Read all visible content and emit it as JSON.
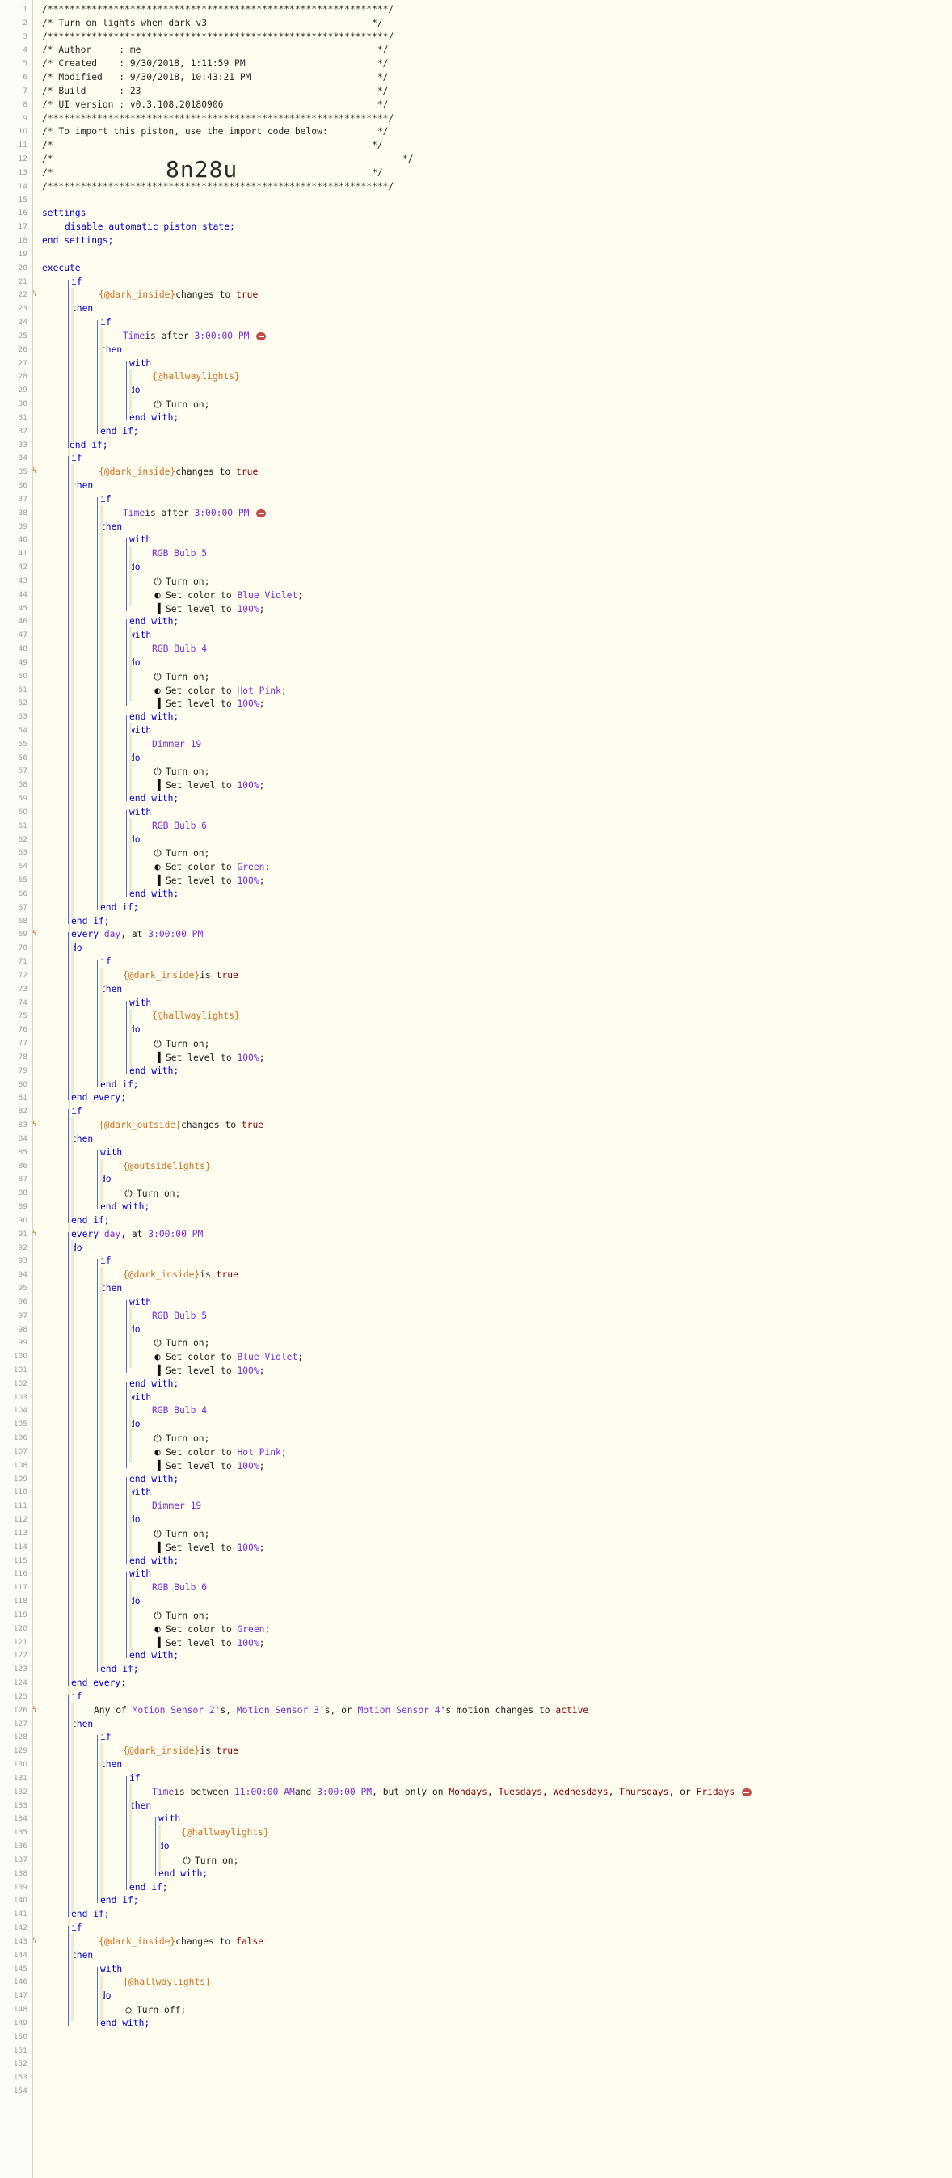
{
  "colors": {
    "keyword": "#0000cc",
    "variable": "#d07020",
    "device": "#7b2fd6",
    "literal": "#8b0000",
    "background": "#fffdf0"
  },
  "line_count": 154,
  "lines": {
    "1": "/**************************************************************/",
    "2": "/* Turn on lights when dark v3                              */",
    "3": "/**************************************************************/",
    "4": "/* Author     : me                                           */",
    "5": "/* Created    : 9/30/2018, 1:11:59 PM                        */",
    "6": "/* Modified   : 9/30/2018, 10:43:21 PM                       */",
    "7": "/* Build      : 23                                           */",
    "8": "/* UI version : v0.3.108.20180906                            */",
    "9": "/**************************************************************/",
    "10": "/* To import this piston, use the import code below:         */",
    "11": "/*                                                          */",
    "12a": "/*",
    "12b": "8n28u",
    "12c": "*/",
    "13": "/*                                                          */",
    "14": "/**************************************************************/",
    "16": "settings",
    "17": "disable automatic piston state;",
    "18": "end settings;",
    "20": "execute",
    "if": "if",
    "then": "then",
    "endif": "end if;",
    "with": "with",
    "do": "do",
    "endwith": "end with;",
    "every": "every",
    "endevery": "end every;",
    "dark_inside": "{@dark_inside}",
    "dark_outside": "{@dark_outside}",
    "hallwaylights": "{@hallwaylights}",
    "outsidelights": "{@outsidelights}",
    "changes_to": "changes to",
    "is": "is",
    "true": "true",
    "false": "false",
    "Time": "Time",
    "is_after": "is after",
    "t300": "3:00:00 PM",
    "turn_on": "Turn on;",
    "turn_off": "Turn off;",
    "set_color_to": "Set color to",
    "set_level_to": "Set level to",
    "pct100": "100%",
    "semicolon": ";",
    "blue_violet": "Blue Violet",
    "hot_pink": "Hot Pink",
    "green": "Green",
    "rgb5": "RGB Bulb 5",
    "rgb4": "RGB Bulb 4",
    "rgb6": "RGB Bulb 6",
    "dimmer19": "Dimmer 19",
    "day": "day",
    "at": ", at",
    "any_of": "Any of",
    "ms2": "Motion Sensor 2",
    "ms3": "Motion Sensor 3",
    "ms4": "Motion Sensor 4",
    "s_comma": "'s,",
    "s_comma_or": "'s, or",
    "motion_changes_to": "'s motion changes to",
    "active": "active",
    "is_between": "is between",
    "t1100": "11:00:00 AM",
    "and": "and",
    "but_only_on": ", but only on",
    "mondays": "Mondays",
    "tuesdays": "Tuesdays",
    "wednesdays": "Wednesdays",
    "thursdays": "Thursdays",
    "or": ", or",
    "fridays": "Fridays",
    "comma": ","
  }
}
